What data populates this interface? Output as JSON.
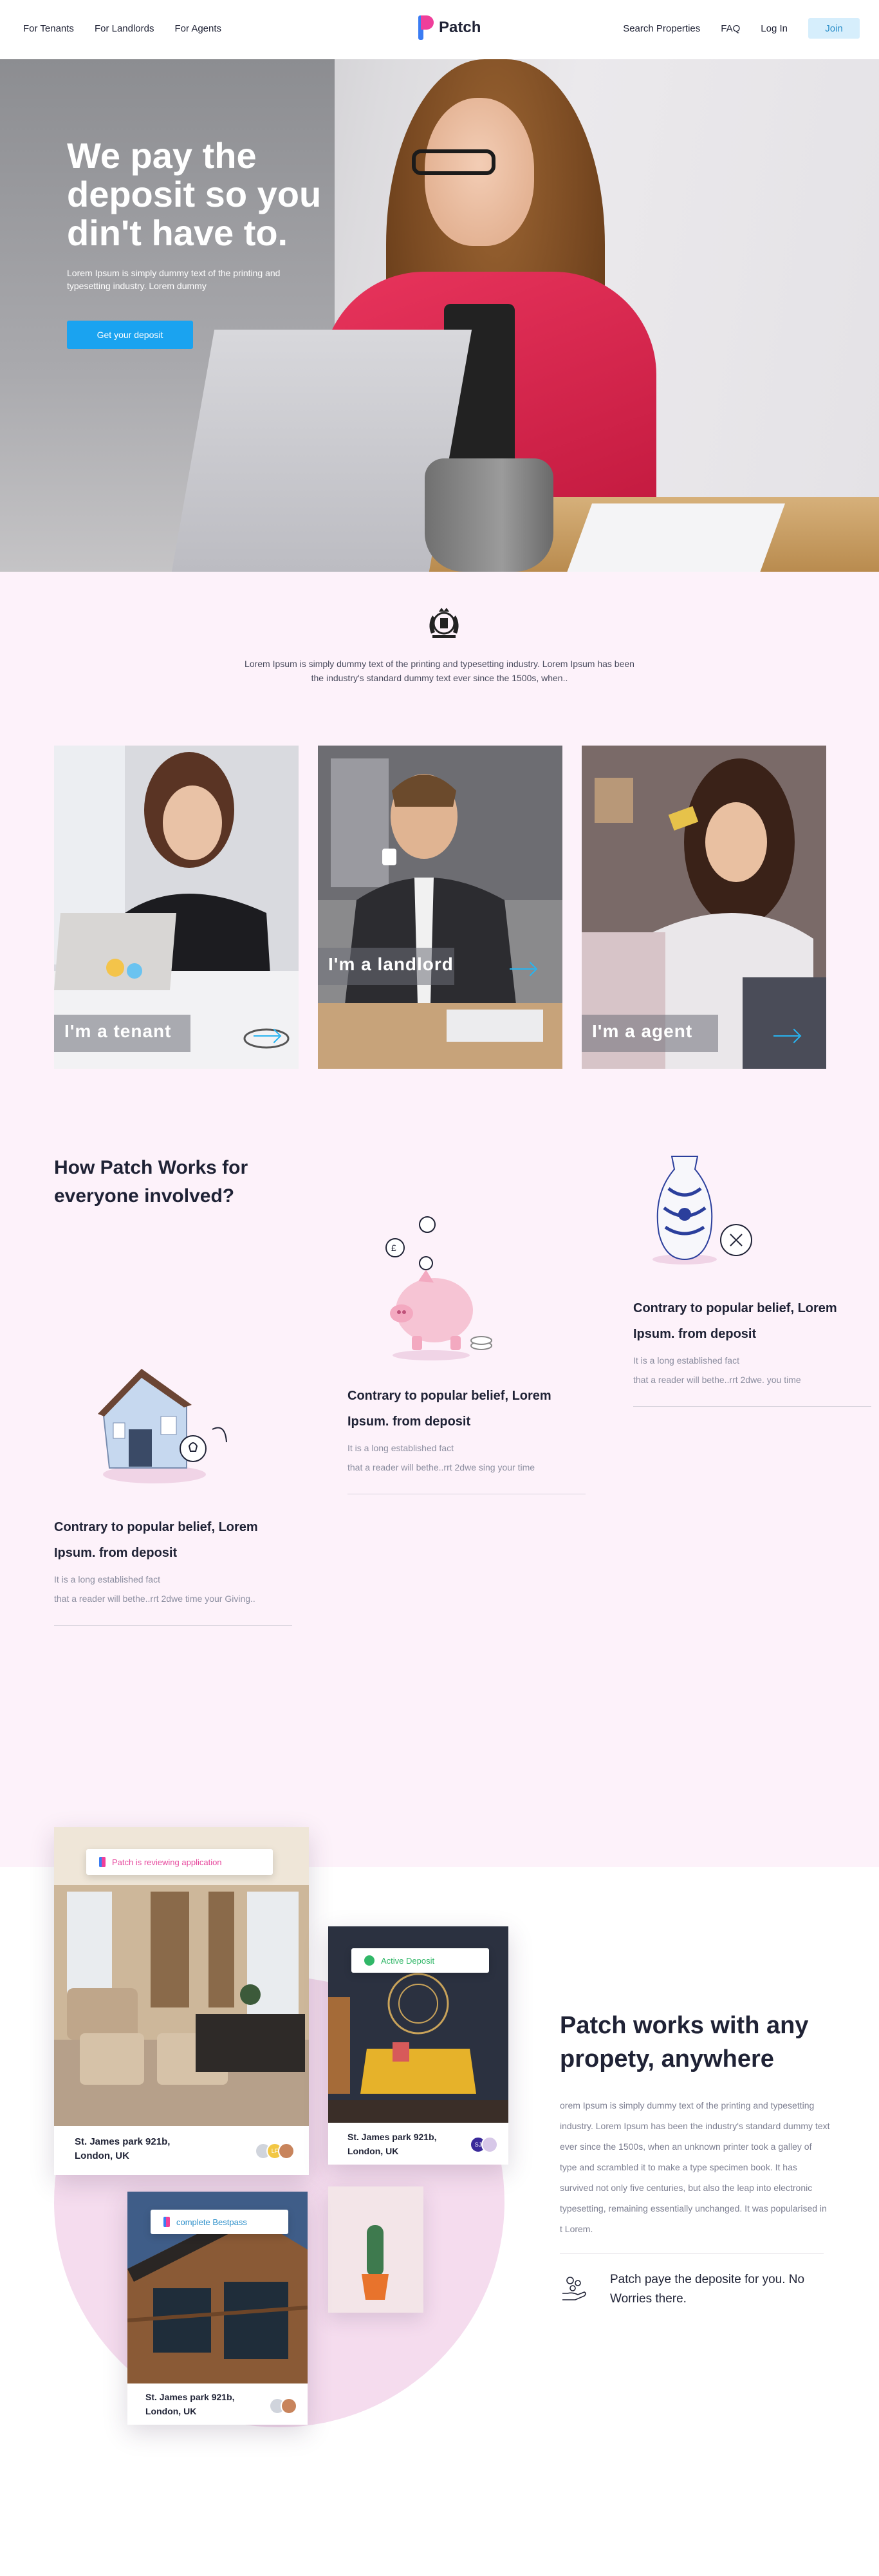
{
  "nav": {
    "left_links": [
      "For Tenants",
      "For Landlords",
      "For Agents"
    ],
    "brand": "Patch",
    "right_links": [
      "Search Properties",
      "FAQ",
      "Log In"
    ],
    "join_label": "Join"
  },
  "hero": {
    "title": "We pay the deposit so you din't  have to.",
    "subtitle": "Lorem Ipsum is simply dummy text of the printing and typesetting industry. Lorem  dummy",
    "cta": "Get your deposit"
  },
  "intro": {
    "crest_icon": "royal-crest-icon",
    "text": "Lorem Ipsum is simply dummy text of the printing and typesetting industry. Lorem Ipsum has been the industry's standard dummy text ever since the 1500s, when.."
  },
  "roles": [
    {
      "label": "I'm  a  tenant"
    },
    {
      "label": "I'm  a  landlord"
    },
    {
      "label": "I'm  a  agent"
    }
  ],
  "how": {
    "title": "How Patch Works for everyone involved?",
    "features": [
      {
        "title": "Contrary to popular belief, Lorem Ipsum. from deposit",
        "desc_1": "It is a long established fact",
        "desc_2": "that a reader will bethe..rrt 2dwe time your Giving.."
      },
      {
        "title": "Contrary to popular belief, Lorem Ipsum. from deposit",
        "desc_1": "It is a long established fact",
        "desc_2": "that a reader will bethe..rrt 2dwe sing your time"
      },
      {
        "title": "Contrary to popular belief, Lorem Ipsum. from deposit",
        "desc_1": "It is a long established fact",
        "desc_2": "that a reader will bethe..rrt 2dwe. you time"
      }
    ]
  },
  "properties": {
    "cards": [
      {
        "badge": "Patch is reviewing application",
        "badge_color": "#e6479d",
        "address_1": "St. James park 921b,",
        "address_2": "London, UK"
      },
      {
        "badge": "Active Deposit",
        "badge_color": "#31b768",
        "address_1": "St. James park 921b,",
        "address_2": "London, UK"
      },
      {
        "badge": "complete Bestpass",
        "badge_color": "#2a8ec9",
        "address_1": "St. James park 921b,",
        "address_2": "London, UK"
      }
    ],
    "avatar_initials": [
      "LF",
      "SJ"
    ],
    "title": "Patch works with any propety, anywhere",
    "body": "orem Ipsum is simply dummy text of the printing and typesetting industry. Lorem Ipsum has been the industry's standard dummy text ever since the 1500s, when an unknown printer took a galley of type and scrambled it to make a type specimen book. It has survived not only five centuries, but also the leap into electronic typesetting, remaining essentially unchanged. It was popularised in t  Lorem.",
    "feature_icon": "hand-coins-icon",
    "feature_text": "Patch paye the deposite for you. No Worries there."
  },
  "colors": {
    "accent": "#1aa3f0",
    "pink_bg": "#fdf2fa",
    "brand_pink": "#ef3f9a",
    "brand_blue": "#3a7cf3"
  }
}
